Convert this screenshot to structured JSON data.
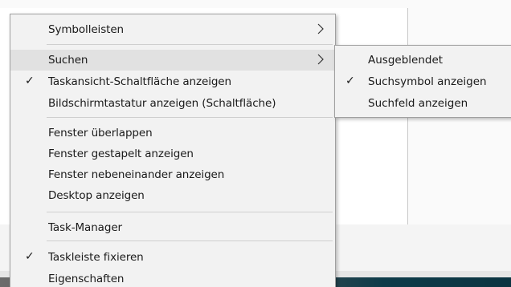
{
  "context_menu": {
    "items": [
      {
        "label": "Symbolleisten",
        "checked": false,
        "submenu": true
      },
      {
        "label": "Suchen",
        "checked": false,
        "submenu": true,
        "highlighted": true
      },
      {
        "label": "Taskansicht-Schaltfläche anzeigen",
        "checked": true,
        "submenu": false
      },
      {
        "label": "Bildschirmtastatur anzeigen (Schaltfläche)",
        "checked": false,
        "submenu": false
      },
      {
        "label": "Fenster überlappen",
        "checked": false,
        "submenu": false
      },
      {
        "label": "Fenster gestapelt anzeigen",
        "checked": false,
        "submenu": false
      },
      {
        "label": "Fenster nebeneinander anzeigen",
        "checked": false,
        "submenu": false
      },
      {
        "label": "Desktop anzeigen",
        "checked": false,
        "submenu": false
      },
      {
        "label": "Task-Manager",
        "checked": false,
        "submenu": false
      },
      {
        "label": "Taskleiste fixieren",
        "checked": true,
        "submenu": false
      },
      {
        "label": "Eigenschaften",
        "checked": false,
        "submenu": false
      }
    ]
  },
  "search_submenu": {
    "items": [
      {
        "label": "Ausgeblendet",
        "checked": false
      },
      {
        "label": "Suchsymbol anzeigen",
        "checked": true
      },
      {
        "label": "Suchfeld anzeigen",
        "checked": false
      }
    ]
  },
  "glyphs": {
    "check": "✓"
  },
  "icons": {
    "submenu_arrow": "chevron-right-icon",
    "checkmark": "checkmark-icon"
  },
  "colors": {
    "menu_background": "#f2f2f2",
    "highlight": "#e1e1e1",
    "separator": "#cfcfcf",
    "text": "#1a1a1a"
  }
}
